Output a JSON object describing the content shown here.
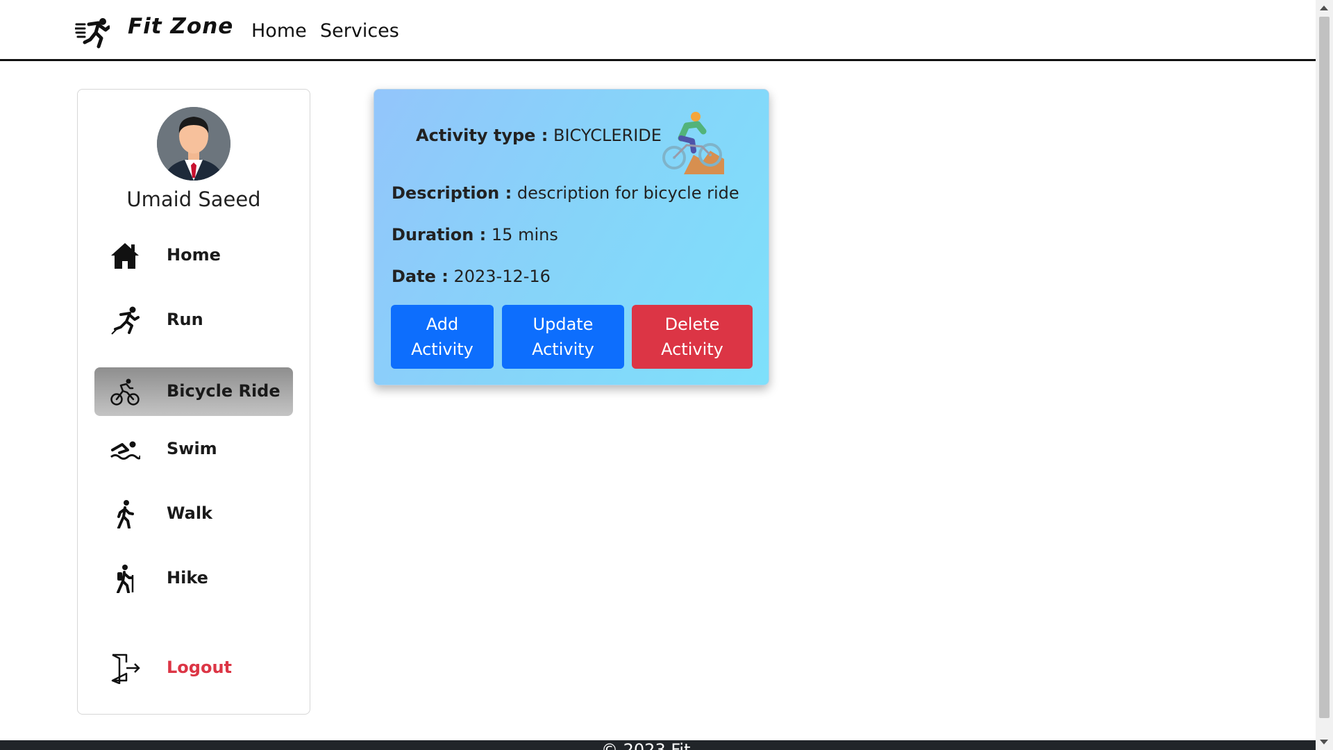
{
  "navbar": {
    "brand": "Fit Zone",
    "links": [
      "Home",
      "Services"
    ]
  },
  "sidebar": {
    "user_name": "Umaid Saeed",
    "items": [
      {
        "label": "Home",
        "icon": "home-icon"
      },
      {
        "label": "Run",
        "icon": "runner-icon"
      },
      {
        "label": "Bicycle Ride",
        "icon": "bicycle-icon",
        "active": true
      },
      {
        "label": "Swim",
        "icon": "swimmer-icon"
      },
      {
        "label": "Walk",
        "icon": "walker-icon"
      },
      {
        "label": "Hike",
        "icon": "hiker-icon"
      }
    ],
    "logout": {
      "label": "Logout",
      "icon": "logout-door-icon"
    }
  },
  "card": {
    "type_label": "Activity type :",
    "type_value": "BICYCLERIDE",
    "desc_label": "Description :",
    "desc_value": "description for bicycle ride",
    "duration_label": "Duration :",
    "duration_value": "15 mins",
    "date_label": "Date :",
    "date_value": "2023-12-16",
    "buttons": {
      "add": "Add Activity",
      "update": "Update Activity",
      "delete": "Delete Activity"
    }
  },
  "footer": {
    "text": "© 2023 Fit"
  },
  "colors": {
    "primary": "#0d6efd",
    "danger": "#dc3545",
    "footer_bg": "#212529"
  }
}
